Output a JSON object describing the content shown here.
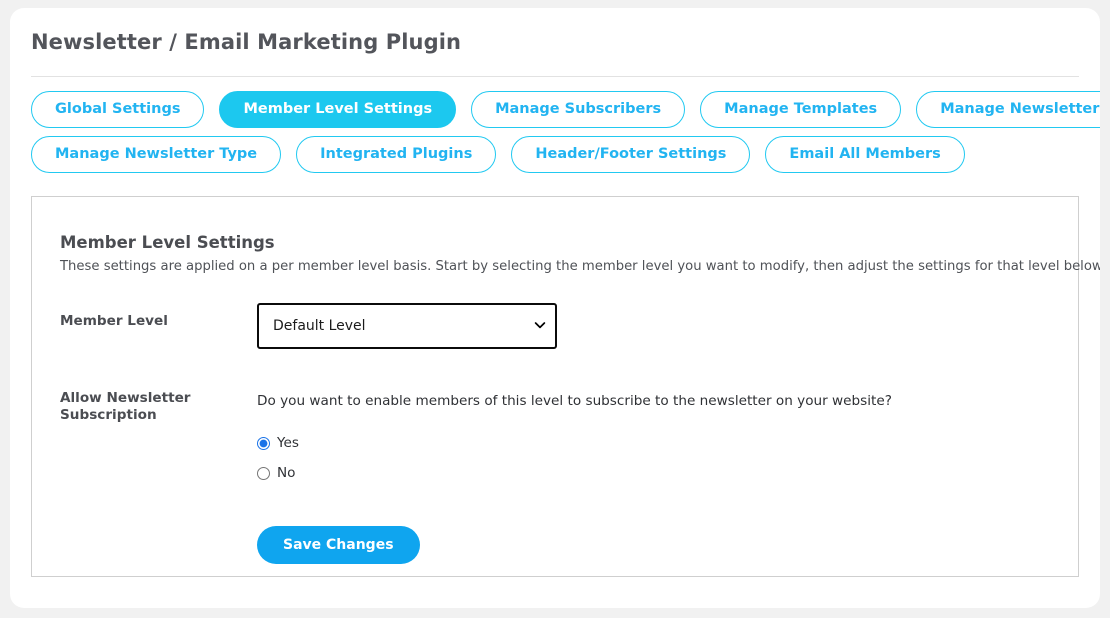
{
  "header": {
    "title": "Newsletter / Email Marketing Plugin"
  },
  "tabs": {
    "row1": [
      {
        "label": "Global Settings",
        "active": false
      },
      {
        "label": "Member Level Settings",
        "active": true
      },
      {
        "label": "Manage Subscribers",
        "active": false
      },
      {
        "label": "Manage Templates",
        "active": false
      },
      {
        "label": "Manage Newsletters",
        "active": false
      }
    ],
    "row2": [
      {
        "label": "Manage Newsletter Type",
        "active": false
      },
      {
        "label": "Integrated Plugins",
        "active": false
      },
      {
        "label": "Header/Footer Settings",
        "active": false
      },
      {
        "label": "Email All Members",
        "active": false
      }
    ]
  },
  "panel": {
    "title": "Member Level Settings",
    "description": "These settings are applied on a per member level basis. Start by selecting the member level you want to modify, then adjust the settings for that level below.",
    "member_level": {
      "label": "Member Level",
      "selected": "Default Level",
      "chevron_icon": "chevron-down-icon"
    },
    "allow_subscription": {
      "label": "Allow Newsletter Subscription",
      "question": "Do you want to enable members of this level to subscribe to the newsletter on your website?",
      "options": [
        {
          "label": "Yes",
          "checked": true
        },
        {
          "label": "No",
          "checked": false
        }
      ]
    },
    "save_label": "Save Changes"
  },
  "colors": {
    "accent_cyan": "#1cc8ef",
    "tab_text": "#22b4f1",
    "button_blue": "#0fa5ef",
    "page_background": "#f1f1f1",
    "panel_border": "#cfcfcf",
    "heading_text": "#4b4d52"
  }
}
